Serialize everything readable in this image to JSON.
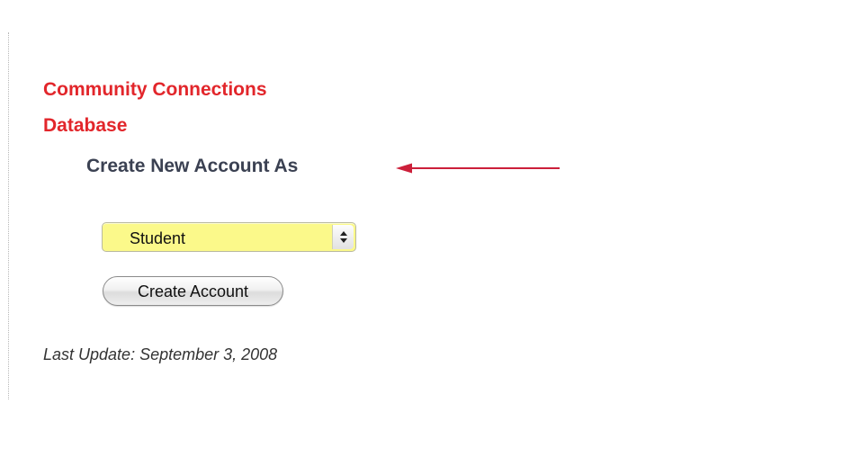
{
  "site": {
    "title_line1": "Community Connections",
    "title_line2": "Database"
  },
  "form": {
    "heading": "Create New Account As",
    "account_type": {
      "selected": "Student"
    },
    "submit_label": "Create Account"
  },
  "footer": {
    "last_update": "Last Update: September 3, 2008"
  },
  "annotation": {
    "arrow_icon": "left-arrow-icon"
  },
  "colors": {
    "title": "#e2262b",
    "heading": "#3b4152",
    "select_background": "#fbf98a",
    "arrow": "#cc1f3a",
    "footer_text": "#333333"
  }
}
